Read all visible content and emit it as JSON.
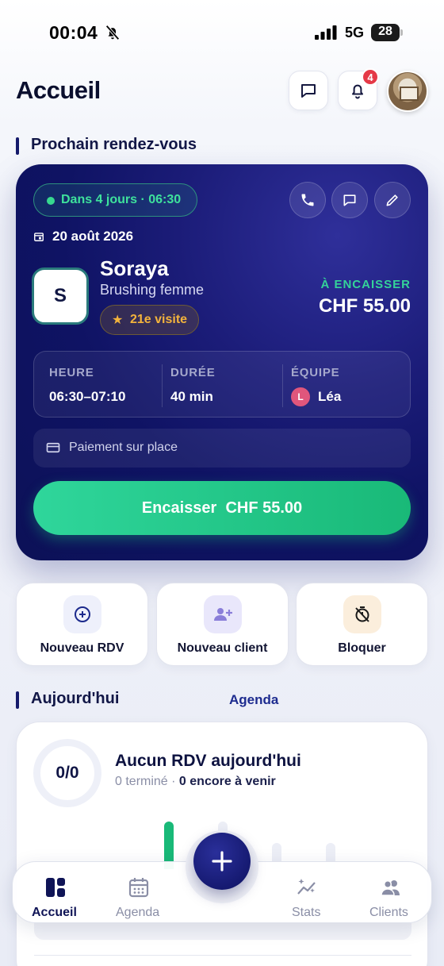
{
  "status_bar": {
    "time": "00:04",
    "network": "5G",
    "battery": "28"
  },
  "header": {
    "title": "Accueil",
    "notification_count": "4"
  },
  "next_appointment": {
    "section_title": "Prochain rendez-vous",
    "countdown": "Dans 4 jours · 06:30",
    "date": "20 août 2026",
    "client_initial": "S",
    "client_name": "Soraya",
    "service": "Brushing femme",
    "visit_badge": "21e visite",
    "due_label": "À ENCAISSER",
    "due_amount": "CHF 55.00",
    "details": {
      "time_label": "HEURE",
      "time_value": "06:30–07:10",
      "duration_label": "DURÉE",
      "duration_value": "40 min",
      "team_label": "ÉQUIPE",
      "team_initial": "L",
      "team_value": "Léa"
    },
    "payment": "Paiement sur place",
    "cta_label": "Encaisser  CHF 55.00"
  },
  "quick_actions": [
    {
      "label": "Nouveau RDV",
      "icon": "plus-circle-icon"
    },
    {
      "label": "Nouveau client",
      "icon": "user-plus-icon"
    },
    {
      "label": "Bloquer",
      "icon": "timer-off-icon"
    }
  ],
  "today": {
    "section_title": "Aujourd'hui",
    "agenda_link": "Agenda",
    "progress": "0/0",
    "title": "Aucun RDV aujourd'hui",
    "done_text": "0 terminé",
    "separator": " · ",
    "upcoming_text": "0 encore à venir"
  },
  "tabbar": {
    "items": [
      {
        "label": "Accueil",
        "icon": "home-grid-icon",
        "active": true
      },
      {
        "label": "Agenda",
        "icon": "calendar-icon",
        "active": false
      },
      {
        "label": "Stats",
        "icon": "sparkle-chart-icon",
        "active": false
      },
      {
        "label": "Clients",
        "icon": "users-icon",
        "active": false
      }
    ]
  },
  "colors": {
    "primary": "#0f1364",
    "accent_green": "#19b978",
    "badge_red": "#e53947",
    "gold": "#f3b33c"
  }
}
